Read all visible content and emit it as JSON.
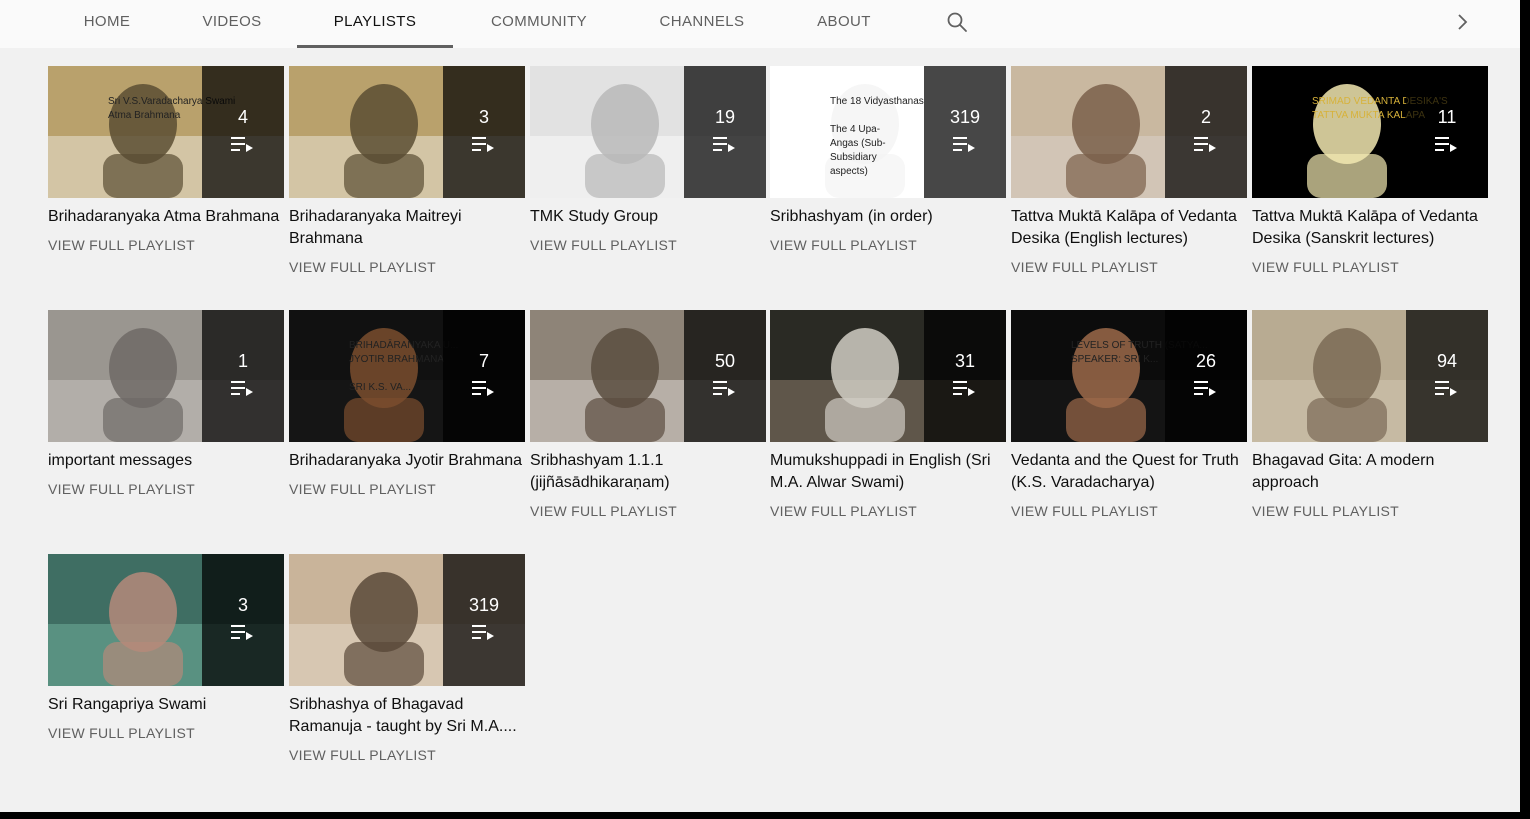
{
  "tabs": [
    {
      "label": "HOME"
    },
    {
      "label": "VIDEOS"
    },
    {
      "label": "PLAYLISTS",
      "active": true
    },
    {
      "label": "COMMUNITY"
    },
    {
      "label": "CHANNELS"
    },
    {
      "label": "ABOUT"
    }
  ],
  "icons": {
    "search": "search-icon",
    "next": "chevron-right-icon",
    "playlist": "playlist-play-icon"
  },
  "view_full_label": "VIEW FULL PLAYLIST",
  "playlists": [
    {
      "count": "4",
      "title": "Brihadaranyaka Atma Brahmana",
      "thumb_text": "Sri V.S.Varadacharya Swami\nAtma Brahmana",
      "palette": [
        "#b9a16c",
        "#5a4d33",
        "#e9e3d5"
      ]
    },
    {
      "count": "3",
      "title": "Brihadaranyaka Maitreyi Brahmana",
      "thumb_text": "",
      "palette": [
        "#b9a16c",
        "#5a4d33",
        "#e9e3d5"
      ]
    },
    {
      "count": "19",
      "title": "TMK Study Group",
      "thumb_text": "",
      "palette": [
        "#e2e2e2",
        "#b8b8b8",
        "#fafafa"
      ]
    },
    {
      "count": "319",
      "title": "Sribhashyam (in order)",
      "thumb_text": "The 18 Vidyasthanas\n\nThe 4 Upa-\nAngas (Sub-\nSubsidiary\naspects)",
      "palette": [
        "#ffffff",
        "#f4f4f4",
        "#ffffff"
      ]
    },
    {
      "count": "2",
      "title": "Tattva Muktā Kalāpa of Vedanta Desika (English lectures)",
      "thumb_text": "",
      "palette": [
        "#c9b8a0",
        "#7a5f4a",
        "#d8d0c8"
      ]
    },
    {
      "count": "11",
      "title": "Tattva Muktā Kalāpa of Vedanta Desika (Sanskrit lectures)",
      "thumb_text": "SRIMAD VEDANTA DESIKA'S\nTATTVA MUKTA KALAPA",
      "palette": [
        "#000000",
        "#f2e8b0",
        "#000000"
      ]
    },
    {
      "count": "1",
      "title": "important messages",
      "thumb_text": "",
      "palette": [
        "#9a9690",
        "#6e6a66",
        "#c7c2bd"
      ]
    },
    {
      "count": "7",
      "title": "Brihadaranyaka Jyotir Brahmana",
      "thumb_text": "BRIHADĀRANYAKA U...\nJYOTIR BRAHMANA\n\nSRI K.S. VA...",
      "palette": [
        "#111111",
        "#7a4d2e",
        "#1a1a1a"
      ]
    },
    {
      "count": "50",
      "title": "Sribhashyam 1.1.1 (jijñāsādhikaraṇam)",
      "thumb_text": "",
      "palette": [
        "#8e8478",
        "#5b4d40",
        "#d8d4ce"
      ]
    },
    {
      "count": "31",
      "title": "Mumukshuppadi in English (Sri M.A. Alwar Swami)",
      "thumb_text": "",
      "palette": [
        "#2a2a24",
        "#d0ccc3",
        "#8a7a6a"
      ]
    },
    {
      "count": "26",
      "title": "Vedanta and the Quest for Truth (K.S. Varadacharya)",
      "thumb_text": "LEVELS OF TRUTH (SATYA...\nSPEAKER: SRI K...",
      "palette": [
        "#0c0c0c",
        "#9c6a4a",
        "#1c1c1c"
      ]
    },
    {
      "count": "94",
      "title": "Bhagavad Gita: A modern approach",
      "thumb_text": "",
      "palette": [
        "#b8ab92",
        "#7a6a55",
        "#d2c7b1"
      ]
    },
    {
      "count": "3",
      "title": "Sri Rangapriya Swami",
      "thumb_text": "",
      "palette": [
        "#3f6e63",
        "#b58a7a",
        "#6fae9a"
      ]
    },
    {
      "count": "319",
      "title": "Sribhashya of Bhagavad Ramanuja - taught by Sri M.A....",
      "thumb_text": "",
      "palette": [
        "#c9b49a",
        "#5b4a3a",
        "#e2d7c7"
      ]
    }
  ]
}
